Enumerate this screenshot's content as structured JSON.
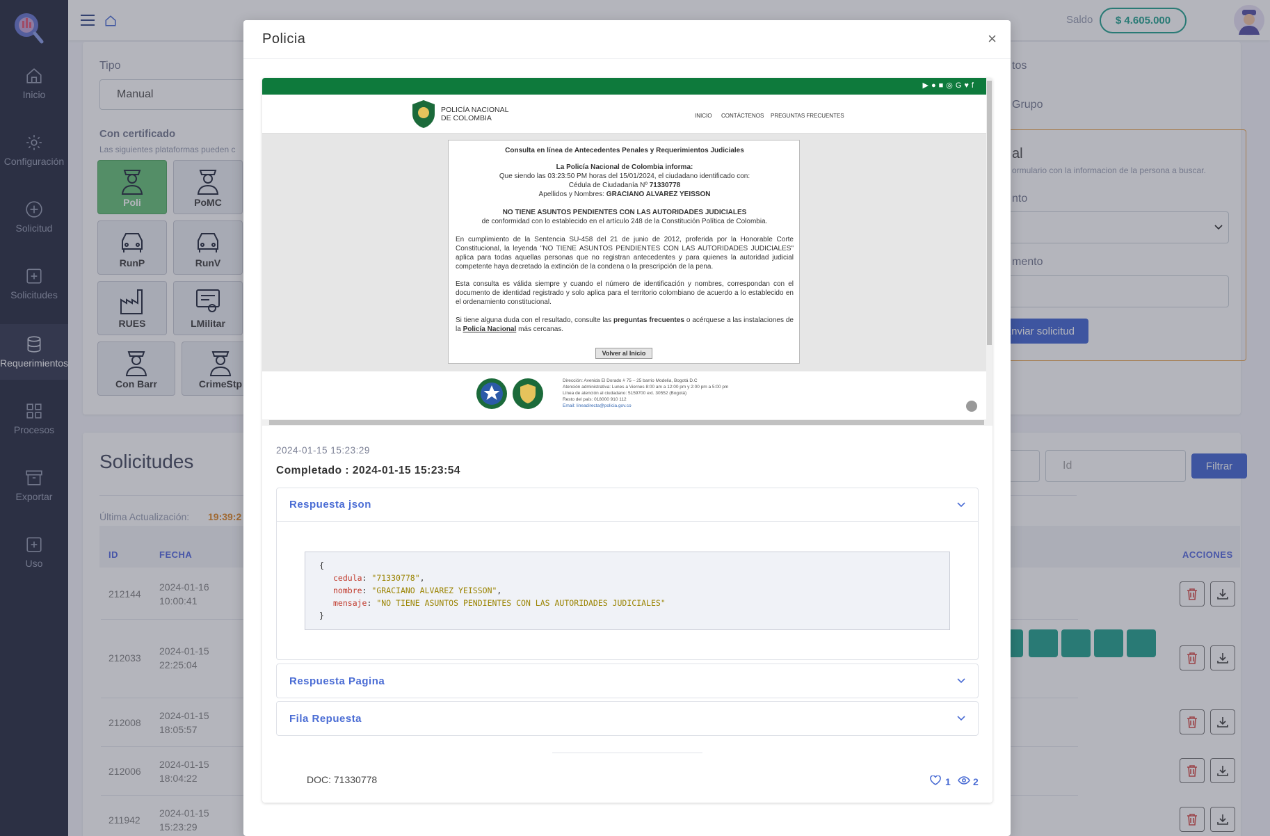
{
  "sidebar": {
    "items": [
      {
        "label": "Inicio",
        "icon": "home-icon"
      },
      {
        "label": "Configuración",
        "icon": "gear-icon"
      },
      {
        "label": "Solicitud",
        "icon": "plus-circle-icon"
      },
      {
        "label": "Solicitudes",
        "icon": "plus-square-icon"
      },
      {
        "label": "Requerimientos",
        "icon": "database-icon"
      },
      {
        "label": "Procesos",
        "icon": "grid-icon"
      },
      {
        "label": "Exportar",
        "icon": "archive-icon"
      },
      {
        "label": "Uso",
        "icon": "plus-square-icon"
      }
    ]
  },
  "header": {
    "saldo_label": "Saldo",
    "saldo_value": "$ 4.605.000"
  },
  "form": {
    "tipo_label": "Tipo",
    "tipo_value": "Manual",
    "cert_label": "Con certificado",
    "cert_desc": "Las siguientes plataformas pueden c",
    "platforms": [
      "Poli",
      "PoMC",
      "RunP",
      "RunV",
      "RUES",
      "LMilitar",
      "Con Barr",
      "CrimeStp"
    ],
    "right_title_frag": "tos",
    "grupo_frag": "Grupo",
    "box_title_frag": "al",
    "box_desc_frag": "ormulario con la informacion de la persona a buscar.",
    "tipo_doc_frag": "nto",
    "doc_frag": "mento",
    "send_btn": "Enviar solicitud"
  },
  "list": {
    "title": "Solicitudes",
    "update_label": "Última Actualización:",
    "update_time": "19:39:2",
    "id_placeholder": "Id",
    "filter_btn": "Filtrar",
    "columns": {
      "id": "ID",
      "fecha": "FECHA",
      "acciones": "ACCIONES"
    },
    "rows": [
      {
        "id": "212144",
        "date": "2024-01-16",
        "time": "10:00:41"
      },
      {
        "id": "212033",
        "date": "2024-01-15",
        "time": "22:25:04"
      },
      {
        "id": "212008",
        "date": "2024-01-15",
        "time": "18:05:57"
      },
      {
        "id": "212006",
        "date": "2024-01-15",
        "time": "18:04:22"
      },
      {
        "id": "211942",
        "date": "2024-01-15",
        "time": "15:23:29"
      }
    ]
  },
  "modal": {
    "title": "Policia",
    "close": "×",
    "shot": {
      "org_line1": "POLICÍA NACIONAL",
      "org_line2": "DE COLOMBIA",
      "nav": [
        "INICIO",
        "CONTÁCTENOS",
        "PREGUNTAS FRECUENTES"
      ],
      "heading": "Consulta en línea de Antecedentes Penales y Requerimientos Judiciales",
      "informs": "La Policía Nacional de Colombia informa:",
      "line_time": "Que siendo las 03:23:50 PM horas del 15/01/2024, el ciudadano identificado con:",
      "line_id_label": "Cédula de Ciudadanía Nº",
      "line_id_value": "71330778",
      "line_name_label": "Apellidos y Nombres:",
      "line_name_value": "GRACIANO ALVAREZ YEISSON",
      "result": "NO TIENE ASUNTOS PENDIENTES CON LAS AUTORIDADES JUDICIALES",
      "result_sub": "de conformidad con lo establecido en el artículo 248 de la Constitución Política de Colombia.",
      "para1": "En cumplimiento de la Sentencia SU-458 del 21 de junio de 2012, proferida por la Honorable Corte Constitucional, la leyenda \"NO TIENE ASUNTOS PENDIENTES CON LAS AUTORIDADES JUDICIALES\" aplica para todas aquellas personas que no registran antecedentes y para quienes la autoridad judicial competente haya decretado la extinción de la condena o la prescripción de la pena.",
      "para2": "Esta consulta es válida siempre y cuando el número de identificación y nombres, correspondan con el documento de identidad registrado y solo aplica para el territorio colombiano de acuerdo a lo establecido en el ordenamiento constitucional.",
      "para3_a": "Si tiene alguna duda con el resultado, consulte las",
      "para3_b": "preguntas frecuentes",
      "para3_c": "o acérquese a las instalaciones de la",
      "para3_d": "Policía Nacional",
      "para3_e": "más cercanas.",
      "back_btn": "Volver al Inicio",
      "footer_lines": [
        "Dirección: Avenida El Dorado # 75 – 25 barrio Modelia, Bogotá D.C",
        "Atención administrativa: Lunes a Viernes 8:00 am a 12:00 pm y 2:00 pm a 5:00 pm",
        "Línea de atención al ciudadano: 5159700 ext. 30552 (Bogotá)",
        "Resto del país: 018000 910 112",
        "Email: lineadirecta@policia.gov.co"
      ]
    },
    "started": "2024-01-15 15:23:29",
    "completed": "Completado : 2024-01-15 15:23:54",
    "sections": [
      "Respuesta json",
      "Respuesta Pagina",
      "Fila Repuesta"
    ],
    "json": {
      "cedula": "\"71330778\"",
      "nombre": "\"GRACIANO ALVAREZ YEISSON\"",
      "mensaje": "\"NO TIENE ASUNTOS PENDIENTES CON LAS AUTORIDADES JUDICIALES\""
    },
    "doc": "DOC: 71330778",
    "likes": "1",
    "views": "2"
  }
}
